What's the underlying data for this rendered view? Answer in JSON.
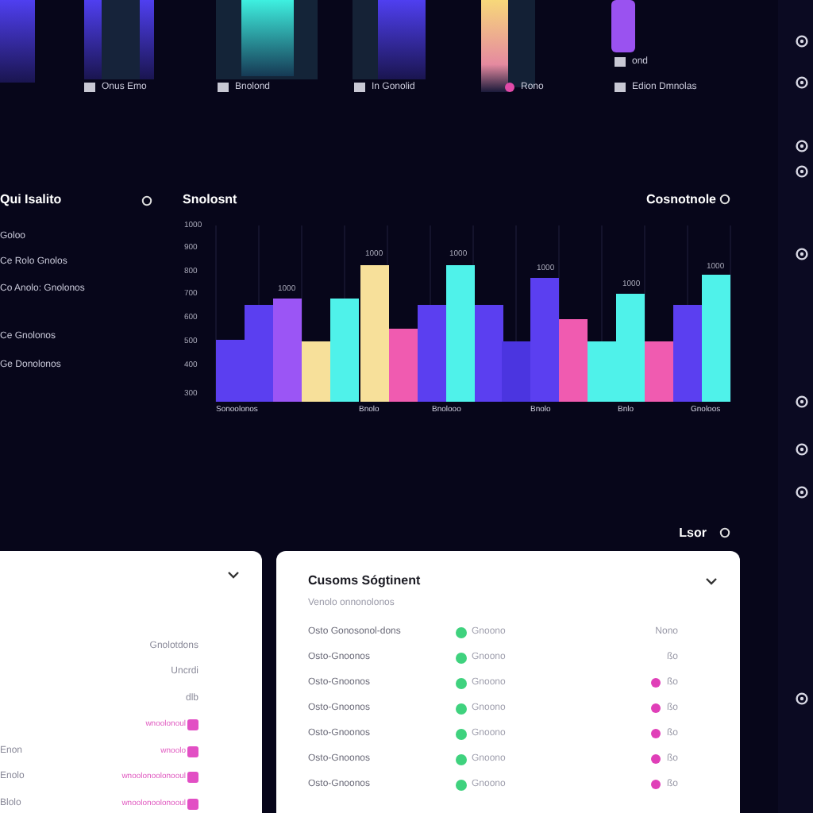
{
  "top_strip": {
    "labels": [
      {
        "kind": "square",
        "text": "Onus Emo"
      },
      {
        "kind": "square",
        "text": "Bnolond"
      },
      {
        "kind": "square",
        "text": "In Gonolid"
      },
      {
        "kind": "dot",
        "text": "Rono"
      },
      {
        "kind": "square",
        "text": "ond"
      },
      {
        "kind": "square",
        "text": "Edion Dmnolas"
      }
    ]
  },
  "left_panel": {
    "title": "Qui Isalito",
    "items": [
      "Goloo",
      "Ce Rolo Gnolos",
      "Co Anolo: Gnolonos",
      "Ce Gnolonos",
      "Ge Donolonos"
    ]
  },
  "chart": {
    "title": "Snolosnt",
    "legend": "Cosnotnole",
    "y_ticks": [
      "1000",
      "900",
      "800",
      "700",
      "600",
      "500",
      "400",
      "300"
    ],
    "value_labels": [
      "1000",
      "1000",
      "1000",
      "1000",
      "1000",
      "1000"
    ],
    "x_labels": [
      "Sonoolonos",
      "Bnolo",
      "Bnolooo",
      "Bnolo",
      "Bnlo",
      "Gnoloos"
    ]
  },
  "section_label": "Lsor",
  "left_card": {
    "rows": [
      {
        "kind": "text",
        "text": "Gnolotdons"
      },
      {
        "kind": "text",
        "text": "Uncrdi"
      },
      {
        "kind": "text",
        "text": "dlb"
      },
      {
        "kind": "bar",
        "label": "",
        "text": "wnoolonoul"
      },
      {
        "kind": "bar",
        "label": "Enon",
        "text": "wnoolo"
      },
      {
        "kind": "bar",
        "label": "Enolo",
        "text": "wnoolonoolonooul"
      },
      {
        "kind": "bar",
        "label": "Blolo",
        "text": "wnoolonoolonooul"
      }
    ]
  },
  "right_card": {
    "title": "Cusoms Sógtinent",
    "subtitle": "Venolo onnonolonos",
    "rows": [
      {
        "name": "Osto Gonosonol-dons",
        "status": "Gnoono",
        "value": "Nono",
        "flag": false
      },
      {
        "name": "Osto-Gnoonos",
        "status": "Gnoono",
        "value": "ßo",
        "flag": false
      },
      {
        "name": "Osto-Gnoonos",
        "status": "Gnoono",
        "value": "ßo",
        "flag": true
      },
      {
        "name": "Osto-Gnoonos",
        "status": "Gnoono",
        "value": "ßo",
        "flag": true
      },
      {
        "name": "Osto-Gnoonos",
        "status": "Gnoono",
        "value": "ßo",
        "flag": true
      },
      {
        "name": "Osto-Gnoonos",
        "status": "Gnoono",
        "value": "ßo",
        "flag": true
      },
      {
        "name": "Osto-Gnoonos",
        "status": "Gnoono",
        "value": "ßo",
        "flag": true
      }
    ]
  }
}
